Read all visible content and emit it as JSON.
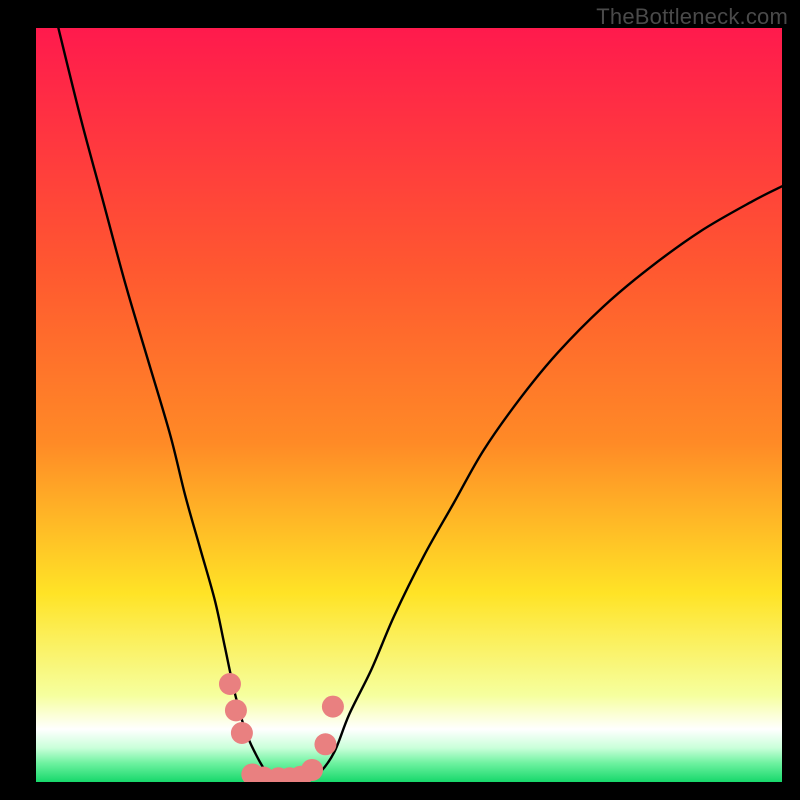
{
  "watermark": "TheBottleneck.com",
  "chart_data": {
    "type": "line",
    "title": "",
    "xlabel": "",
    "ylabel": "",
    "xlim": [
      0,
      100
    ],
    "ylim": [
      0,
      100
    ],
    "background_gradient": {
      "top": "#ff1a4d",
      "upper_mid": "#ff8a26",
      "mid": "#ffe326",
      "lower_mid": "#f6ff9e",
      "bottom": "#17d86b"
    },
    "series": [
      {
        "name": "left-arm",
        "x": [
          3,
          6,
          9,
          12,
          15,
          18,
          20,
          22,
          24,
          25.3,
          26.6,
          28,
          29.3,
          31,
          32.8
        ],
        "y": [
          100,
          88,
          77,
          66,
          56,
          46,
          38,
          31,
          24,
          18,
          12,
          7,
          4,
          1.2,
          0.5
        ]
      },
      {
        "name": "right-arm",
        "x": [
          36.5,
          38,
          40,
          42,
          45,
          48,
          52,
          56,
          60,
          65,
          70,
          76,
          82,
          89,
          96,
          100
        ],
        "y": [
          0.5,
          1.2,
          4,
          9,
          15,
          22,
          30,
          37,
          44,
          51,
          57,
          63,
          68,
          73,
          77,
          79
        ]
      },
      {
        "name": "markers-left",
        "x": [
          26.0,
          26.8,
          27.6
        ],
        "y": [
          13.0,
          9.5,
          6.5
        ]
      },
      {
        "name": "markers-floor",
        "x": [
          29.0,
          30.5,
          32.5,
          34.0,
          35.5,
          37.0
        ],
        "y": [
          1.0,
          0.6,
          0.5,
          0.5,
          0.7,
          1.6
        ]
      },
      {
        "name": "markers-right",
        "x": [
          38.8,
          39.8
        ],
        "y": [
          5.0,
          10.0
        ]
      }
    ]
  }
}
